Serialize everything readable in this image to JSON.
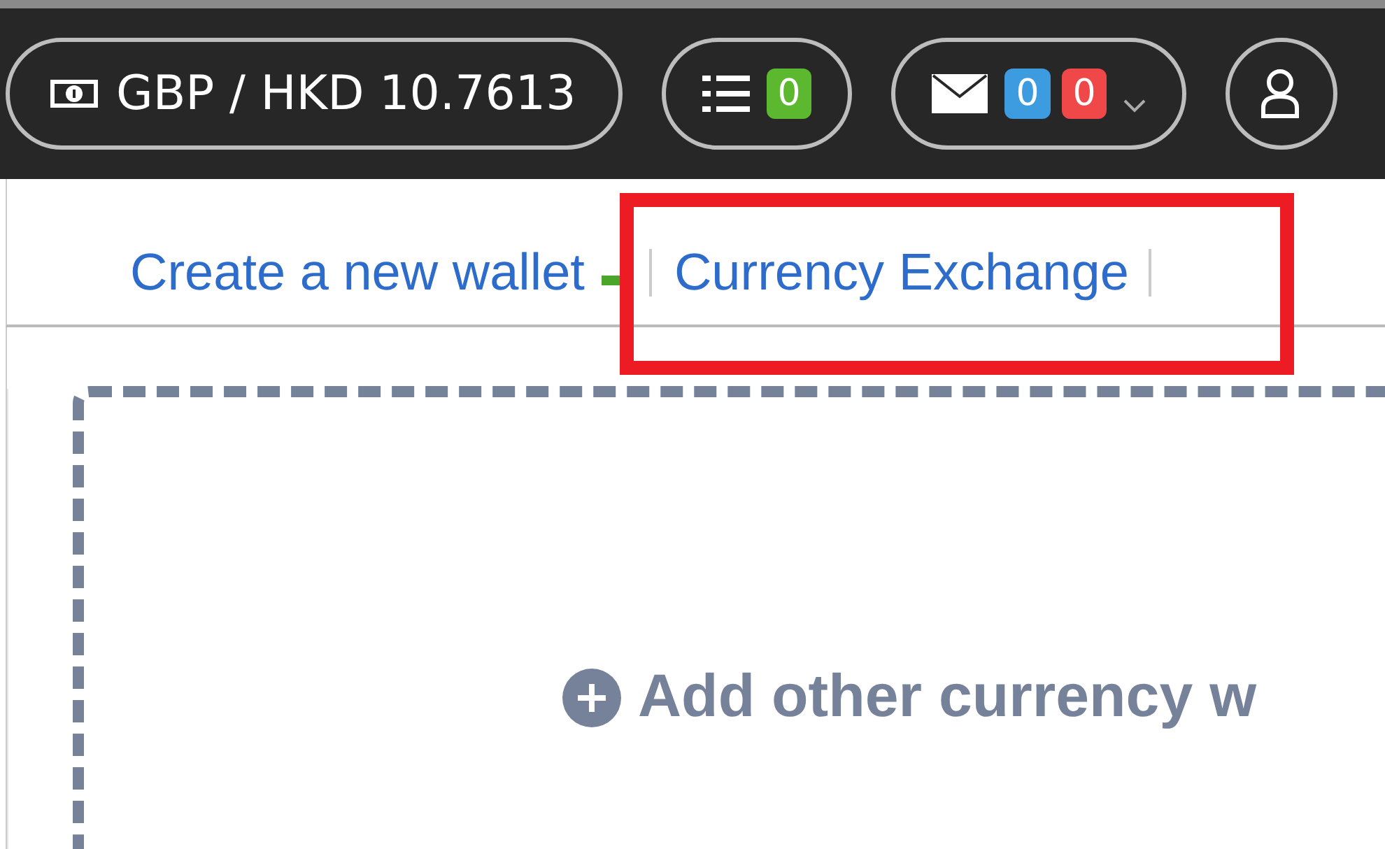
{
  "header": {
    "rate_pill": {
      "text": "GBP / HKD 10.7613"
    },
    "tasks_pill": {
      "badges": [
        {
          "count": "0",
          "color": "#5cb82f"
        }
      ]
    },
    "messages_pill": {
      "badges": [
        {
          "count": "0",
          "color": "#3d9be0"
        },
        {
          "count": "0",
          "color": "#f04848"
        }
      ]
    }
  },
  "links": [
    {
      "label": "Create a new wallet",
      "new": true
    },
    {
      "label": "Currency Exchange",
      "new": false
    }
  ],
  "add_wallet": {
    "label": "Add other currency w"
  }
}
